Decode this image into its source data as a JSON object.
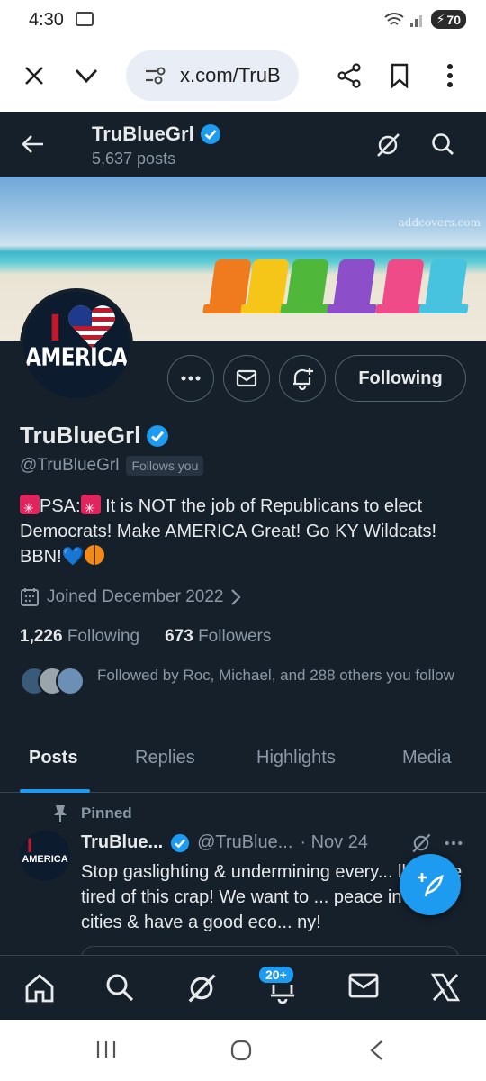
{
  "status_bar": {
    "time": "4:30",
    "battery": "70"
  },
  "browser": {
    "url": "x.com/TruB"
  },
  "header": {
    "name": "TruBlueGrl",
    "posts_count": "5,637 posts"
  },
  "banner": {
    "watermark": "addcovers.com"
  },
  "avatar": {
    "text": "AMERICA",
    "letter": "I"
  },
  "actions": {
    "following_label": "Following"
  },
  "profile": {
    "name": "TruBlueGrl",
    "handle": "@TruBlueGrl",
    "follows_you": "Follows you",
    "bio_psa": "PSA:",
    "bio_text": " It is NOT the job of Republicans to elect Democrats! Make AMERICA Great! Go KY Wildcats! BBN!",
    "joined": "Joined December 2022",
    "following_count": "1,226",
    "following_label": "Following",
    "followers_count": "673",
    "followers_label": "Followers",
    "followed_by": "Followed by Roc, Michael, and 288 others you follow"
  },
  "tabs": [
    {
      "label": "Posts"
    },
    {
      "label": "Replies"
    },
    {
      "label": "Highlights"
    },
    {
      "label": "Media"
    }
  ],
  "pinned_post": {
    "pinned_label": "Pinned",
    "name": "TruBlue...",
    "handle": "@TruBlue...",
    "date": "· Nov 24",
    "text": "Stop gaslighting & undermining every... ll! We're tired of this crap!  We want to ... peace in safe cities & have a good eco... ny!",
    "avatar_text": "AMERICA"
  },
  "bottom_nav": {
    "notifications_badge": "20+"
  },
  "colors": {
    "accent": "#1d9bf0",
    "background": "#15202b",
    "muted": "#8b98a5"
  },
  "icons": [
    "close-icon",
    "chevron-down-icon",
    "site-settings-icon",
    "share-icon",
    "bookmark-icon",
    "more-vert-icon",
    "back-arrow-icon",
    "grok-icon",
    "search-icon",
    "more-horiz-icon",
    "mail-icon",
    "notification-add-icon",
    "verified-badge-icon",
    "calendar-icon",
    "chevron-right-icon",
    "pin-icon",
    "compose-icon",
    "home-icon",
    "bell-icon",
    "x-logo-icon"
  ]
}
